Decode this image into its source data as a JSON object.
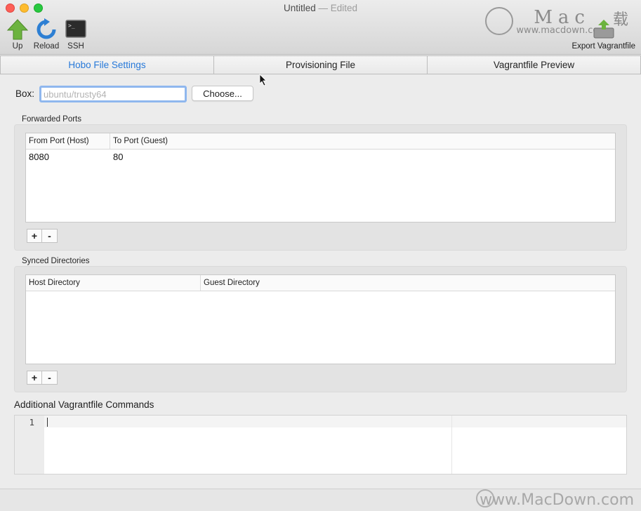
{
  "window": {
    "title": "Untitled",
    "edited": "— Edited"
  },
  "toolbar": {
    "up_label": "Up",
    "reload_label": "Reload",
    "ssh_label": "SSH",
    "export_label": "Export Vagrantfile"
  },
  "watermark": {
    "big": "Mac",
    "cn": "载",
    "url": "www.macdown.com",
    "footer": "www.MacDown.com"
  },
  "tabs": [
    {
      "label": "Hobo File Settings",
      "active": true
    },
    {
      "label": "Provisioning File",
      "active": false
    },
    {
      "label": "Vagrantfile Preview",
      "active": false
    }
  ],
  "box": {
    "label": "Box:",
    "placeholder": "ubuntu/trusty64",
    "choose_label": "Choose..."
  },
  "forwarded_ports": {
    "title": "Forwarded Ports",
    "columns": [
      "From Port (Host)",
      "To Port (Guest)"
    ],
    "rows": [
      [
        "8080",
        "80"
      ]
    ],
    "add": "+",
    "remove": "-"
  },
  "synced_dirs": {
    "title": "Synced Directories",
    "columns": [
      "Host Directory",
      "Guest Directory"
    ],
    "rows": [],
    "add": "+",
    "remove": "-"
  },
  "commands": {
    "title": "Additional Vagrantfile Commands",
    "line_number": "1"
  },
  "colors": {
    "accent": "#2779d9",
    "close": "#fd5f57",
    "minimize": "#febc2e",
    "zoom": "#28c840"
  }
}
